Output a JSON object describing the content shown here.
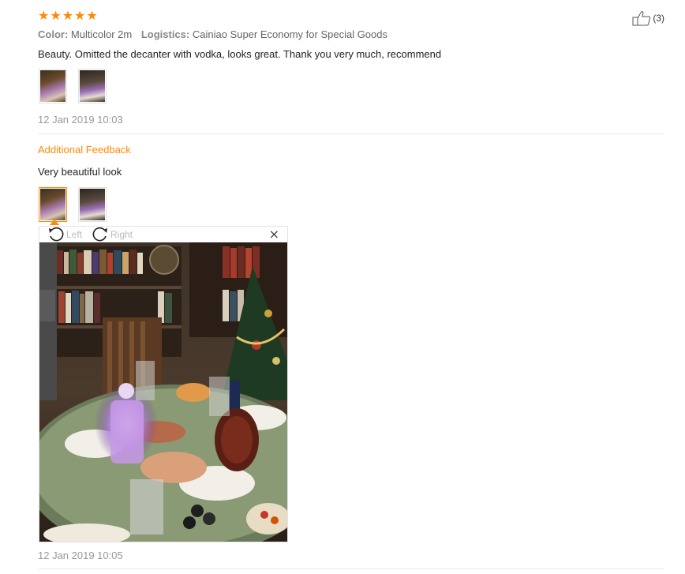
{
  "review": {
    "rating": 5,
    "color_label": "Color:",
    "color_value": "Multicolor 2m",
    "logistics_label": "Logistics:",
    "logistics_value": "Cainiao Super Economy for Special Goods",
    "text": "Beauty. Omitted the decanter with vodka, looks great. Thank you very much, recommend",
    "date": "12 Jan 2019 10:03",
    "helpful_count": "(3)"
  },
  "additional": {
    "title": "Additional Feedback",
    "text": "Very beautiful look",
    "date": "12 Jan 2019 10:05"
  },
  "viewer": {
    "rotate_left_label": "Left",
    "rotate_right_label": "Right",
    "close_glyph": "×"
  },
  "colors": {
    "accent": "#ff8a00",
    "muted": "#999999"
  },
  "icons": [
    "star-icon",
    "thumbs-up-icon",
    "rotate-left-icon",
    "rotate-right-icon",
    "close-icon"
  ]
}
